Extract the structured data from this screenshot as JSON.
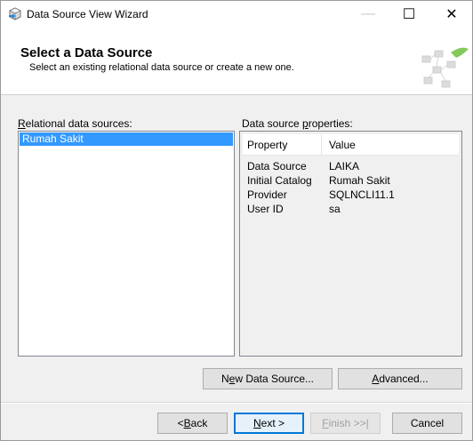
{
  "window": {
    "title": "Data Source View Wizard",
    "icon": "wizard-cube-icon"
  },
  "titlebar": {
    "minimize": "—",
    "maximize": "☐",
    "close": "✕"
  },
  "header": {
    "title": "Select a Data Source",
    "subtitle": "Select an existing relational data source or create a new one."
  },
  "left_panel": {
    "label_prefix": "",
    "label_accel": "R",
    "label_rest": "elational data sources:",
    "items": [
      "Rumah Sakit"
    ],
    "selected_index": 0
  },
  "right_panel": {
    "label_pre": "Data source ",
    "label_accel": "p",
    "label_post": "roperties:",
    "columns": [
      "Property",
      "Value"
    ],
    "rows": [
      {
        "property": "Data Source",
        "value": "LAIKA"
      },
      {
        "property": "Initial Catalog",
        "value": "Rumah Sakit"
      },
      {
        "property": "Provider",
        "value": "SQLNCLI11.1"
      },
      {
        "property": "User ID",
        "value": "sa"
      }
    ]
  },
  "actions": {
    "new_pre": "N",
    "new_accel": "e",
    "new_post": "w Data Source...",
    "adv_pre": "",
    "adv_accel": "A",
    "adv_post": "dvanced..."
  },
  "footer": {
    "back_pre": "< ",
    "back_accel": "B",
    "back_post": "ack",
    "next_pre": "",
    "next_accel": "N",
    "next_post": "ext >",
    "finish_pre": "",
    "finish_accel": "F",
    "finish_post": "inish >>|",
    "cancel": "Cancel"
  },
  "colors": {
    "selection": "#3399ff",
    "focus_border": "#0078d7"
  }
}
